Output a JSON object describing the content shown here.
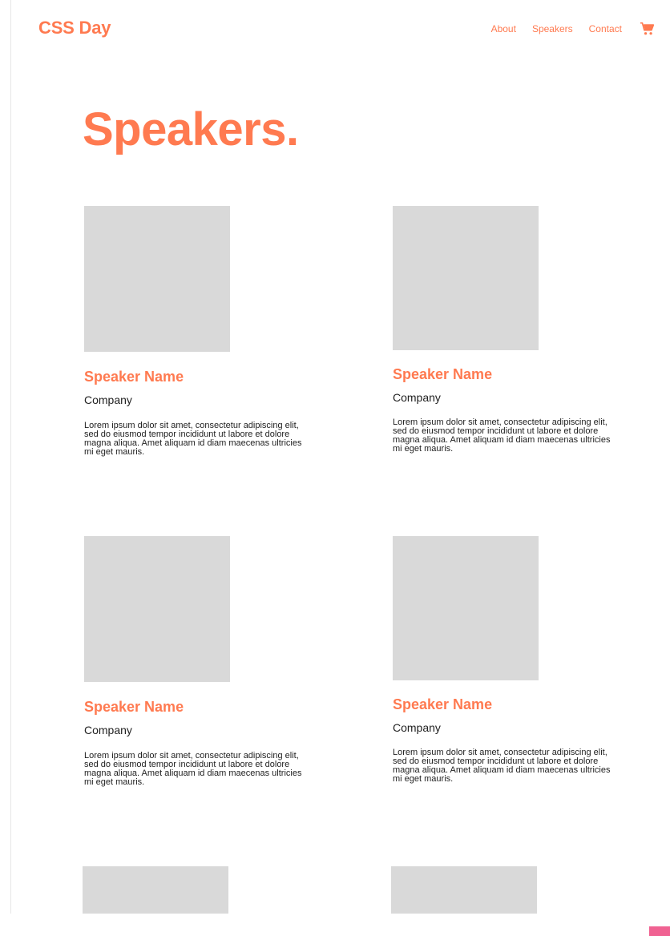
{
  "header": {
    "brand": "CSS Day",
    "nav": [
      "About",
      "Speakers",
      "Contact"
    ],
    "cart_icon": "shopping-cart-icon"
  },
  "page": {
    "title": "Speakers."
  },
  "speakers": [
    {
      "name": "Speaker Name",
      "company": "Company",
      "bio": "Lorem ipsum dolor sit amet, consectetur adipiscing elit, sed do eiusmod tempor incididunt ut labore et dolore magna aliqua. Amet aliquam id diam maecenas ultricies mi eget mauris."
    },
    {
      "name": "Speaker Name",
      "company": "Company",
      "bio": "Lorem ipsum dolor sit amet, consectetur adipiscing elit, sed do eiusmod tempor incididunt ut labore et dolore magna aliqua. Amet aliquam id diam maecenas ultricies mi eget mauris."
    },
    {
      "name": "Speaker Name",
      "company": "Company",
      "bio": "Lorem ipsum dolor sit amet, consectetur adipiscing elit, sed do eiusmod tempor incididunt ut labore et dolore magna aliqua. Amet aliquam id diam maecenas ultricies mi eget mauris."
    },
    {
      "name": "Speaker Name",
      "company": "Company",
      "bio": "Lorem ipsum dolor sit amet, consectetur adipiscing elit, sed do eiusmod tempor incididunt ut labore et dolore magna aliqua. Amet aliquam id diam maecenas ultricies mi eget mauris."
    }
  ],
  "colors": {
    "accent": "#ff7a50",
    "placeholder": "#d9d9d9",
    "text": "#222222"
  }
}
